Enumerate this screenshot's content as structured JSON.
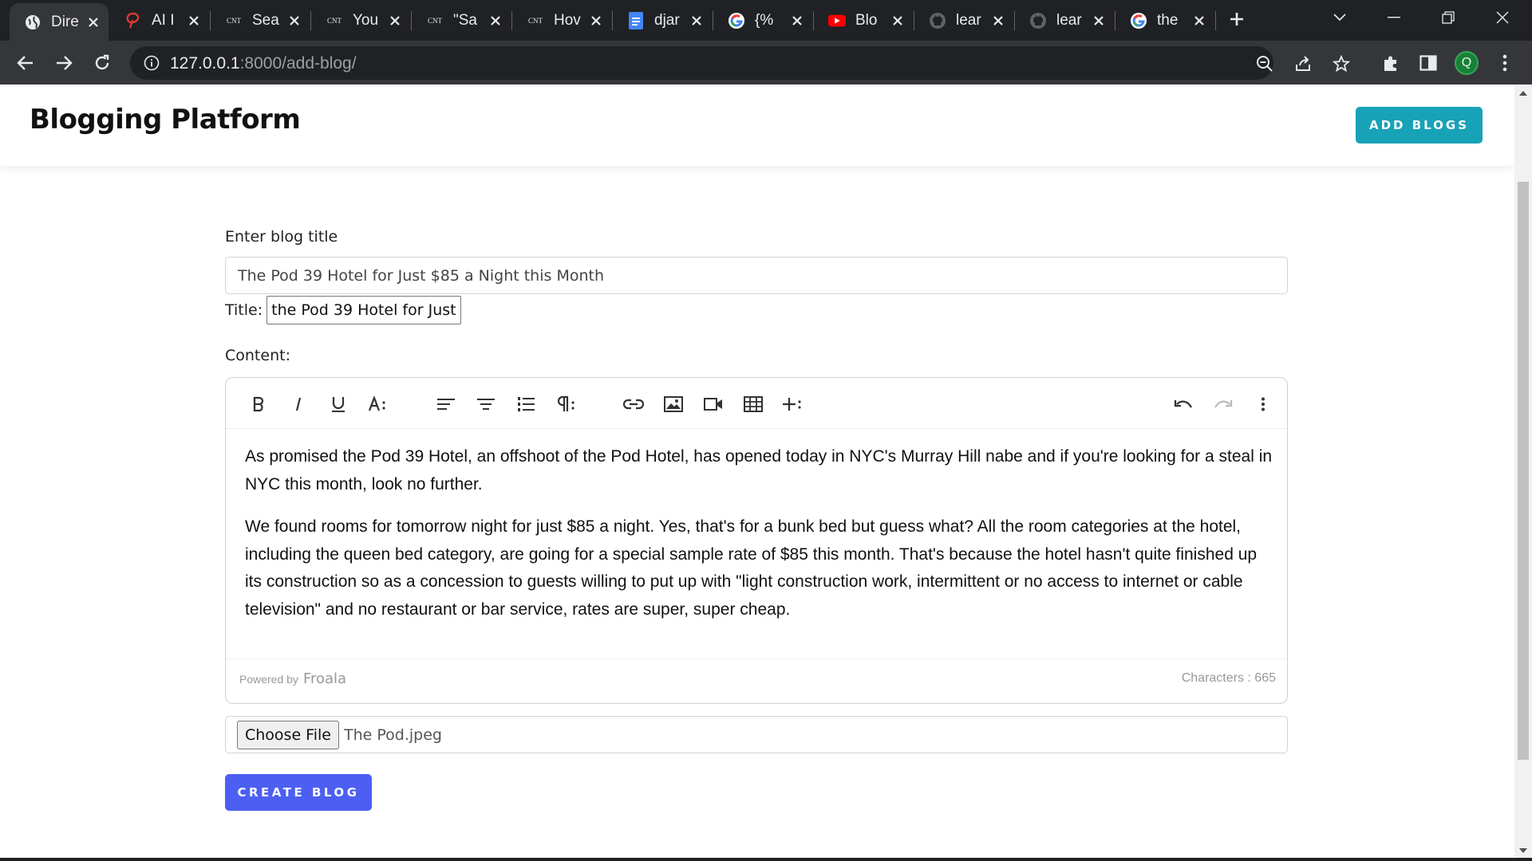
{
  "browser": {
    "tabs": [
      {
        "title": "Dire",
        "icon": "globe-icon"
      },
      {
        "title": "AI I",
        "icon": "pinterest-icon"
      },
      {
        "title": "Sea",
        "icon": "cnt-icon"
      },
      {
        "title": "You",
        "icon": "cnt-icon"
      },
      {
        "title": "\"Sa",
        "icon": "cnt-icon"
      },
      {
        "title": "Hov",
        "icon": "cnt-icon"
      },
      {
        "title": "djar",
        "icon": "docs-icon"
      },
      {
        "title": "{% ",
        "icon": "google-icon"
      },
      {
        "title": "Blo",
        "icon": "youtube-icon"
      },
      {
        "title": "lear",
        "icon": "github-icon"
      },
      {
        "title": "lear",
        "icon": "github-icon"
      },
      {
        "title": "the",
        "icon": "google-icon"
      }
    ],
    "cnt_label": "CNT",
    "url_host": "127.0.0.1",
    "url_path": ":8000/add-blog/",
    "profile_initial": "Q"
  },
  "header": {
    "brand": "Blogging Platform",
    "add_button": "ADD BLOGS"
  },
  "form": {
    "title_label": "Enter blog title",
    "title_value": "The Pod 39 Hotel for Just $85 a Night this Month",
    "title_small_label": "Title:",
    "title_small_value": "the Pod 39 Hotel for Just",
    "content_label": "Content:",
    "content_paragraphs": [
      "As promised the Pod 39 Hotel, an offshoot of the Pod Hotel, has opened today in NYC's Murray Hill nabe and if you're looking for a steal in NYC this month, look no further.",
      "We found rooms for tomorrow night for just $85 a night. Yes, that's for a bunk bed but guess what? All the room categories at the hotel, including the queen bed category, are going for a special sample rate of $85 this month. That's because the hotel hasn't quite finished up its construction so as a concession to guests willing to put up with \"light construction work, intermittent or no access to internet or cable television\" and no restaurant or bar service, rates are super, super cheap."
    ],
    "powered_by": "Powered by",
    "froala": "Froala",
    "char_count": "Characters : 665",
    "choose_file": "Choose File",
    "file_name": "The Pod.jpeg",
    "create_button": "CREATE BLOG"
  },
  "colors": {
    "add_button": "#17a2b8",
    "create_button": "#4c5ff2",
    "tabbar": "#202124",
    "toolbar": "#35363a"
  }
}
